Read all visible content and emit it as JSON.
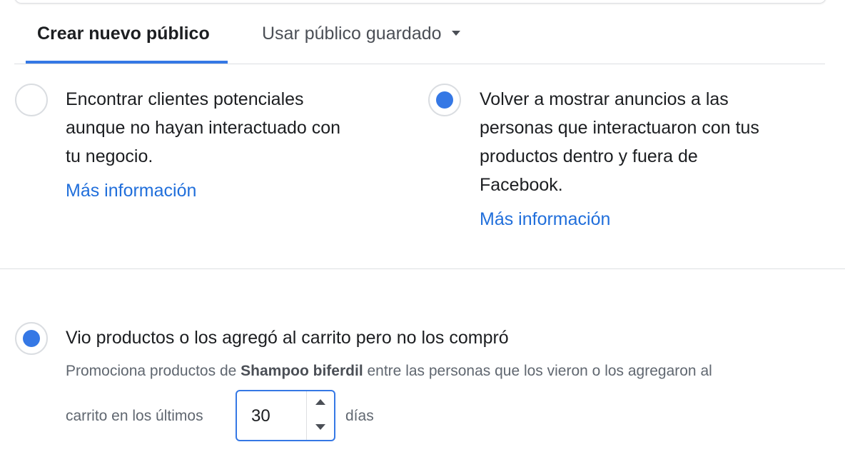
{
  "tabs": {
    "active": "Crear nuevo público",
    "inactive": "Usar público guardado"
  },
  "options": {
    "left": {
      "line1": "Encontrar clientes potenciales",
      "line2": "aunque no hayan interactuado con",
      "line3": "tu negocio.",
      "link": "Más información",
      "selected": false
    },
    "right": {
      "line1": "Volver a mostrar anuncios a las",
      "line2": "personas que interactuaron con tus",
      "line3": "productos dentro y fuera de",
      "line4": "Facebook.",
      "link": "Más información",
      "selected": true
    }
  },
  "retarget": {
    "title": "Vio productos o los agregó al carrito pero no los compró",
    "desc_prefix": "Promociona productos de ",
    "store_name": "Shampoo biferdil",
    "desc_suffix": " entre las personas que los vieron o los agregaron al",
    "desc_line2": "carrito en los últimos",
    "days_value": "30",
    "days_label": "días"
  },
  "colors": {
    "accent": "#3578e5",
    "link": "#216fdb",
    "border": "#dddfe2"
  }
}
